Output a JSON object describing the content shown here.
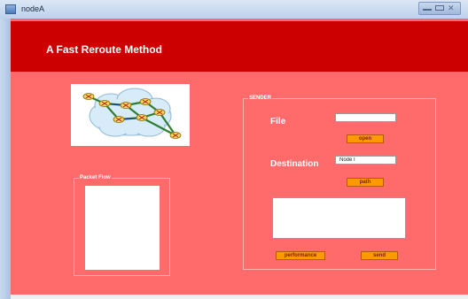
{
  "window": {
    "title": "nodeA",
    "icon": "java-app-icon",
    "controls": [
      "minimize-icon",
      "maximize-icon",
      "close-icon"
    ]
  },
  "header": {
    "title": "A Fast Reroute Method",
    "background": "#cc0000"
  },
  "topology_image": {
    "description_icon": "network-topology-icon"
  },
  "packet_flow": {
    "label": "Packet Flow"
  },
  "sender": {
    "label": "SENDER",
    "file_label": "File",
    "file_value": "",
    "open_button": "open",
    "destination_label": "Destination",
    "destination_value": "Node I",
    "path_button": "path",
    "message_text": "",
    "performance_button": "performance",
    "send_button": "send"
  },
  "colors": {
    "panel": "#ff6b6b",
    "button": "#ff9900"
  }
}
